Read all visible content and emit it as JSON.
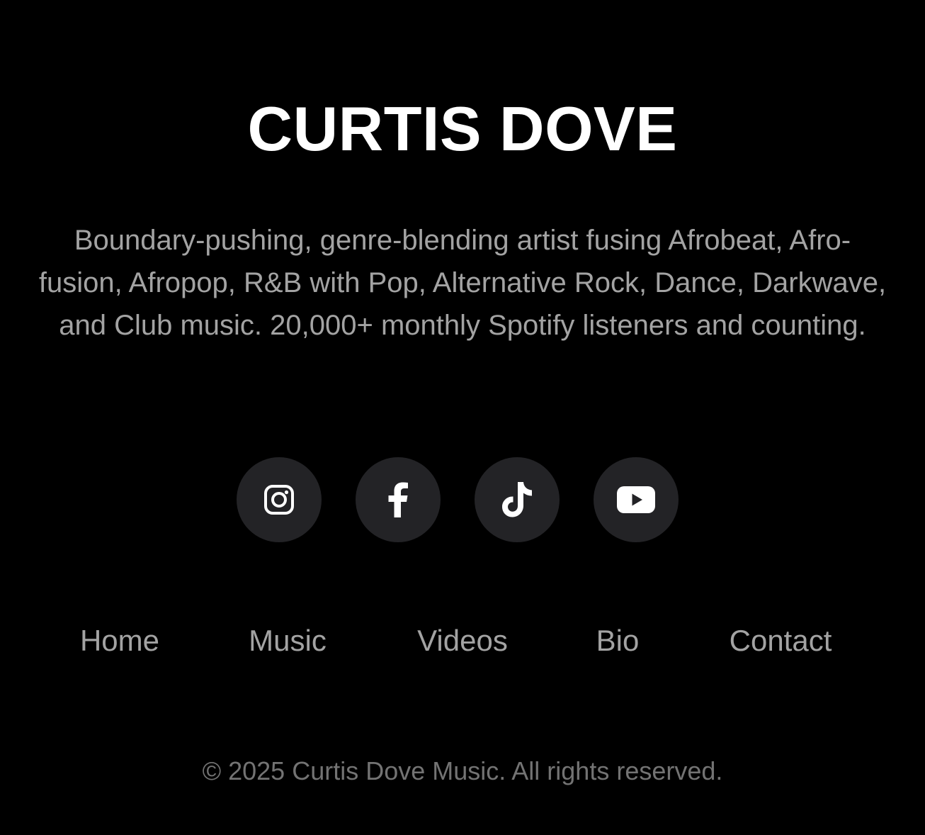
{
  "brand": {
    "title": "CURTIS DOVE"
  },
  "bio": {
    "text": "Boundary-pushing, genre-blending artist fusing Afrobeat, Afro-fusion, Afropop, R&B with Pop, Alternative Rock, Dance, Darkwave, and Club music. 20,000+ monthly Spotify listeners and counting."
  },
  "social": [
    {
      "icon": "instagram-icon"
    },
    {
      "icon": "facebook-icon"
    },
    {
      "icon": "tiktok-icon"
    },
    {
      "icon": "youtube-icon"
    }
  ],
  "nav": {
    "items": [
      {
        "label": "Home"
      },
      {
        "label": "Music"
      },
      {
        "label": "Videos"
      },
      {
        "label": "Bio"
      },
      {
        "label": "Contact"
      }
    ]
  },
  "footer": {
    "copyright": "© 2025 Curtis Dove Music. All rights reserved."
  },
  "colors": {
    "background": "#000000",
    "title": "#ffffff",
    "body_text": "#a3a3a3",
    "muted_text": "#737373",
    "icon_button_bg": "#232326",
    "icon": "#ffffff"
  }
}
